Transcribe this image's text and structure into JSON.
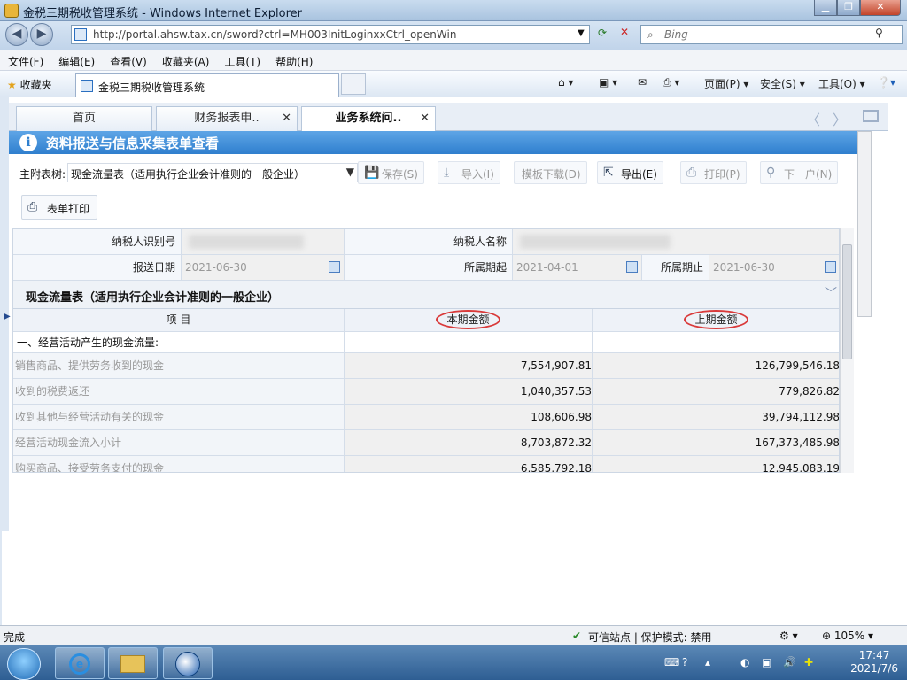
{
  "window": {
    "title": "金税三期税收管理系统 - Windows Internet Explorer",
    "url": "http://portal.ahsw.tax.cn/sword?ctrl=MH003InitLoginxxCtrl_openWin",
    "search_placeholder": "Bing"
  },
  "menu": [
    "文件(F)",
    "编辑(E)",
    "查看(V)",
    "收藏夹(A)",
    "工具(T)",
    "帮助(H)"
  ],
  "favbar": {
    "favorites": "收藏夹",
    "tab_title": "金税三期税收管理系统",
    "commands": [
      "页面(P)",
      "安全(S)",
      "工具(O)"
    ]
  },
  "app_tabs": [
    {
      "label": "首页",
      "closable": false,
      "active": false
    },
    {
      "label": "财务报表申..",
      "closable": true,
      "active": false
    },
    {
      "label": "业务系统问..",
      "closable": true,
      "active": true
    }
  ],
  "header": {
    "title": "资料报送与信息采集表单查看",
    "icon": "info-icon"
  },
  "toolbar": {
    "tree_label": "主附表树:",
    "tree_value": "现金流量表（适用执行企业会计准则的一般企业）",
    "buttons": [
      {
        "label": "保存(S)",
        "icon": "save-icon",
        "enabled": false
      },
      {
        "label": "导入(I)",
        "icon": "import-icon",
        "enabled": false
      },
      {
        "label": "模板下载(D)",
        "icon": "",
        "enabled": false
      },
      {
        "label": "导出(E)",
        "icon": "export-icon",
        "enabled": true
      },
      {
        "label": "打印(P)",
        "icon": "printer-icon",
        "enabled": false
      },
      {
        "label": "下一户(N)",
        "icon": "search-icon",
        "enabled": false
      }
    ],
    "print_form": "表单打印"
  },
  "form": {
    "taxpayer_id_label": "纳税人识别号",
    "taxpayer_name_label": "纳税人名称",
    "submit_date_label": "报送日期",
    "submit_date": "2021-06-30",
    "period_start_label": "所属期起",
    "period_start": "2021-04-01",
    "period_end_label": "所属期止",
    "period_end": "2021-06-30"
  },
  "table": {
    "section_title": "现金流量表（适用执行企业会计准则的一般企业）",
    "columns": [
      "项 目",
      "本期金额",
      "上期金额"
    ],
    "rows": [
      {
        "item": "一、经营活动产生的现金流量:",
        "current": "",
        "prior": "",
        "heading": true
      },
      {
        "item": "销售商品、提供劳务收到的现金",
        "current": "7,554,907.81",
        "prior": "126,799,546.18"
      },
      {
        "item": "收到的税费返还",
        "current": "1,040,357.53",
        "prior": "779,826.82"
      },
      {
        "item": "收到其他与经营活动有关的现金",
        "current": "108,606.98",
        "prior": "39,794,112.98"
      },
      {
        "item": "经营活动现金流入小计",
        "current": "8,703,872.32",
        "prior": "167,373,485.98"
      },
      {
        "item": "购买商品、接受劳务支付的现金",
        "current": "6,585,792.18",
        "prior": "12,945,083.19"
      }
    ]
  },
  "status": {
    "left": "完成",
    "zone": "可信站点 | 保护模式: 禁用",
    "zoom": "105%"
  },
  "taskbar": {
    "time": "17:47",
    "date": "2021/7/6"
  },
  "colors": {
    "header_blue": "#2f7fce",
    "highlight_ring": "#d93a3a"
  }
}
